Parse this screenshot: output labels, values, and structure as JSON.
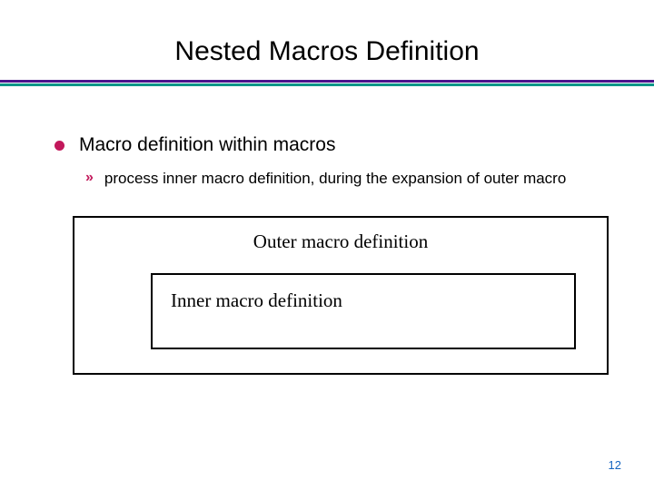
{
  "title": "Nested Macros Definition",
  "bullet": {
    "text": "Macro definition within macros"
  },
  "sub_bullet": {
    "marker": "»",
    "text": "process inner macro definition, during the expansion of outer macro"
  },
  "diagram": {
    "outer_label": "Outer macro definition",
    "inner_label": "Inner macro definition"
  },
  "page_number": "12",
  "colors": {
    "accent_pink": "#c2185b",
    "divider_purple": "#4a148c",
    "divider_teal": "#009688",
    "page_num": "#1565c0"
  }
}
